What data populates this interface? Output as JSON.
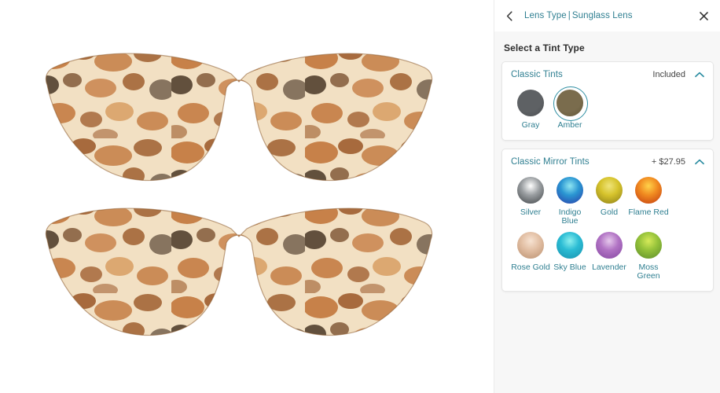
{
  "header": {
    "back_icon": "chevron-left-icon",
    "breadcrumb_parent": "Lens Type",
    "breadcrumb_sep": "|",
    "breadcrumb_current": "Sunglass Lens",
    "close_icon": "close-icon"
  },
  "panel": {
    "section_title": "Select a Tint Type"
  },
  "colors": {
    "accent": "#2f7f91",
    "accent_ring": "#2f8fa3",
    "panel_bg": "#f7f7f7",
    "card_bg": "#ffffff",
    "text_dark": "#2e2e2e"
  },
  "groups": [
    {
      "title": "Classic Tints",
      "price": "Included",
      "expanded": true,
      "chevron_icon": "chevron-up-icon",
      "swatches": [
        {
          "label": "Gray",
          "selected": false,
          "style": "flat",
          "color": "#5e6164",
          "edge": "#4b4e51"
        },
        {
          "label": "Amber",
          "selected": true,
          "style": "flat",
          "color": "#7a6c4d",
          "edge": "#625636"
        }
      ]
    },
    {
      "title": "Classic Mirror Tints",
      "price": "+ $27.95",
      "expanded": true,
      "chevron_icon": "chevron-up-icon",
      "swatches": [
        {
          "label": "Silver",
          "selected": false,
          "style": "gloss",
          "hi": "#ffffff",
          "mid": "#9a9ea1",
          "edge": "#3f4346"
        },
        {
          "label": "Indigo Blue",
          "selected": false,
          "style": "gloss",
          "hi": "#8fe6f2",
          "mid": "#2a96d2",
          "edge": "#2a3ba8"
        },
        {
          "label": "Gold",
          "selected": false,
          "style": "gloss",
          "hi": "#efe47a",
          "mid": "#d6c32c",
          "edge": "#8a7c18"
        },
        {
          "label": "Flame Red",
          "selected": false,
          "style": "gloss",
          "hi": "#ffd24a",
          "mid": "#f08a20",
          "edge": "#c23a10"
        },
        {
          "label": "Rose Gold",
          "selected": false,
          "style": "gloss",
          "hi": "#f7e3d2",
          "mid": "#e2bfa4",
          "edge": "#b98f6e"
        },
        {
          "label": "Sky Blue",
          "selected": false,
          "style": "gloss",
          "hi": "#8df0ef",
          "mid": "#2bbcd4",
          "edge": "#1790ad"
        },
        {
          "label": "Lavender",
          "selected": false,
          "style": "gloss",
          "hi": "#e6c9ec",
          "mid": "#b173c4",
          "edge": "#8446a0"
        },
        {
          "label": "Moss Green",
          "selected": false,
          "style": "gloss",
          "hi": "#d6ea5a",
          "mid": "#95c23a",
          "edge": "#5a8a2a"
        }
      ]
    }
  ],
  "preview": {
    "name": "sunglasses-preview",
    "frame_pattern": "tortoiseshell",
    "items": [
      {
        "name": "sunglasses-top",
        "lens_tint": "Amber",
        "lens_color": "#6e6a4e",
        "mirrored": false
      },
      {
        "name": "sunglasses-bottom",
        "lens_tint": "Rose Gold",
        "lens_color": "#d6b9a6",
        "mirrored": true
      }
    ],
    "frame_colors": {
      "cream": "#f2e0c3",
      "tan": "#d79a5c",
      "orange": "#c2773c",
      "brown": "#9a5626",
      "dark": "#3f2c1c"
    }
  }
}
